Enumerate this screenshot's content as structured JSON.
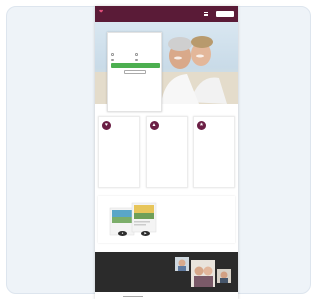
{
  "colors": {
    "brand": "#5a1b37",
    "accent": "#e9537f",
    "cta": "#4caf50",
    "footer": "#2b2b2b",
    "card_background": "#eef3f8"
  },
  "header": {
    "logo_icon": "heart-logo-icon",
    "logo_text": "",
    "menu_icon": "hamburger-menu-icon",
    "login_label": ""
  },
  "hero": {
    "image": "smiling-couple-beach-photo",
    "form": {
      "title": "",
      "gender_label": "",
      "gender_options": [
        "",
        ""
      ],
      "seeking_label": "",
      "seeking_options": [
        "",
        ""
      ],
      "cta_label": "",
      "alt_label": ""
    }
  },
  "features": [
    {
      "icon": "heart-icon",
      "title": "",
      "text": "",
      "link": ""
    },
    {
      "icon": "people-icon",
      "title": "",
      "text": "",
      "link": ""
    },
    {
      "icon": "star-icon",
      "title": "",
      "text": "",
      "link": ""
    }
  ],
  "app_section": {
    "image": "phone-app-screenshots",
    "title": "",
    "text": "",
    "link": "",
    "store_icons": [
      "apple-icon",
      "play-store-icon"
    ]
  },
  "footer": {
    "title": "",
    "text": "",
    "link": "",
    "image": "couples-photo-collage"
  }
}
